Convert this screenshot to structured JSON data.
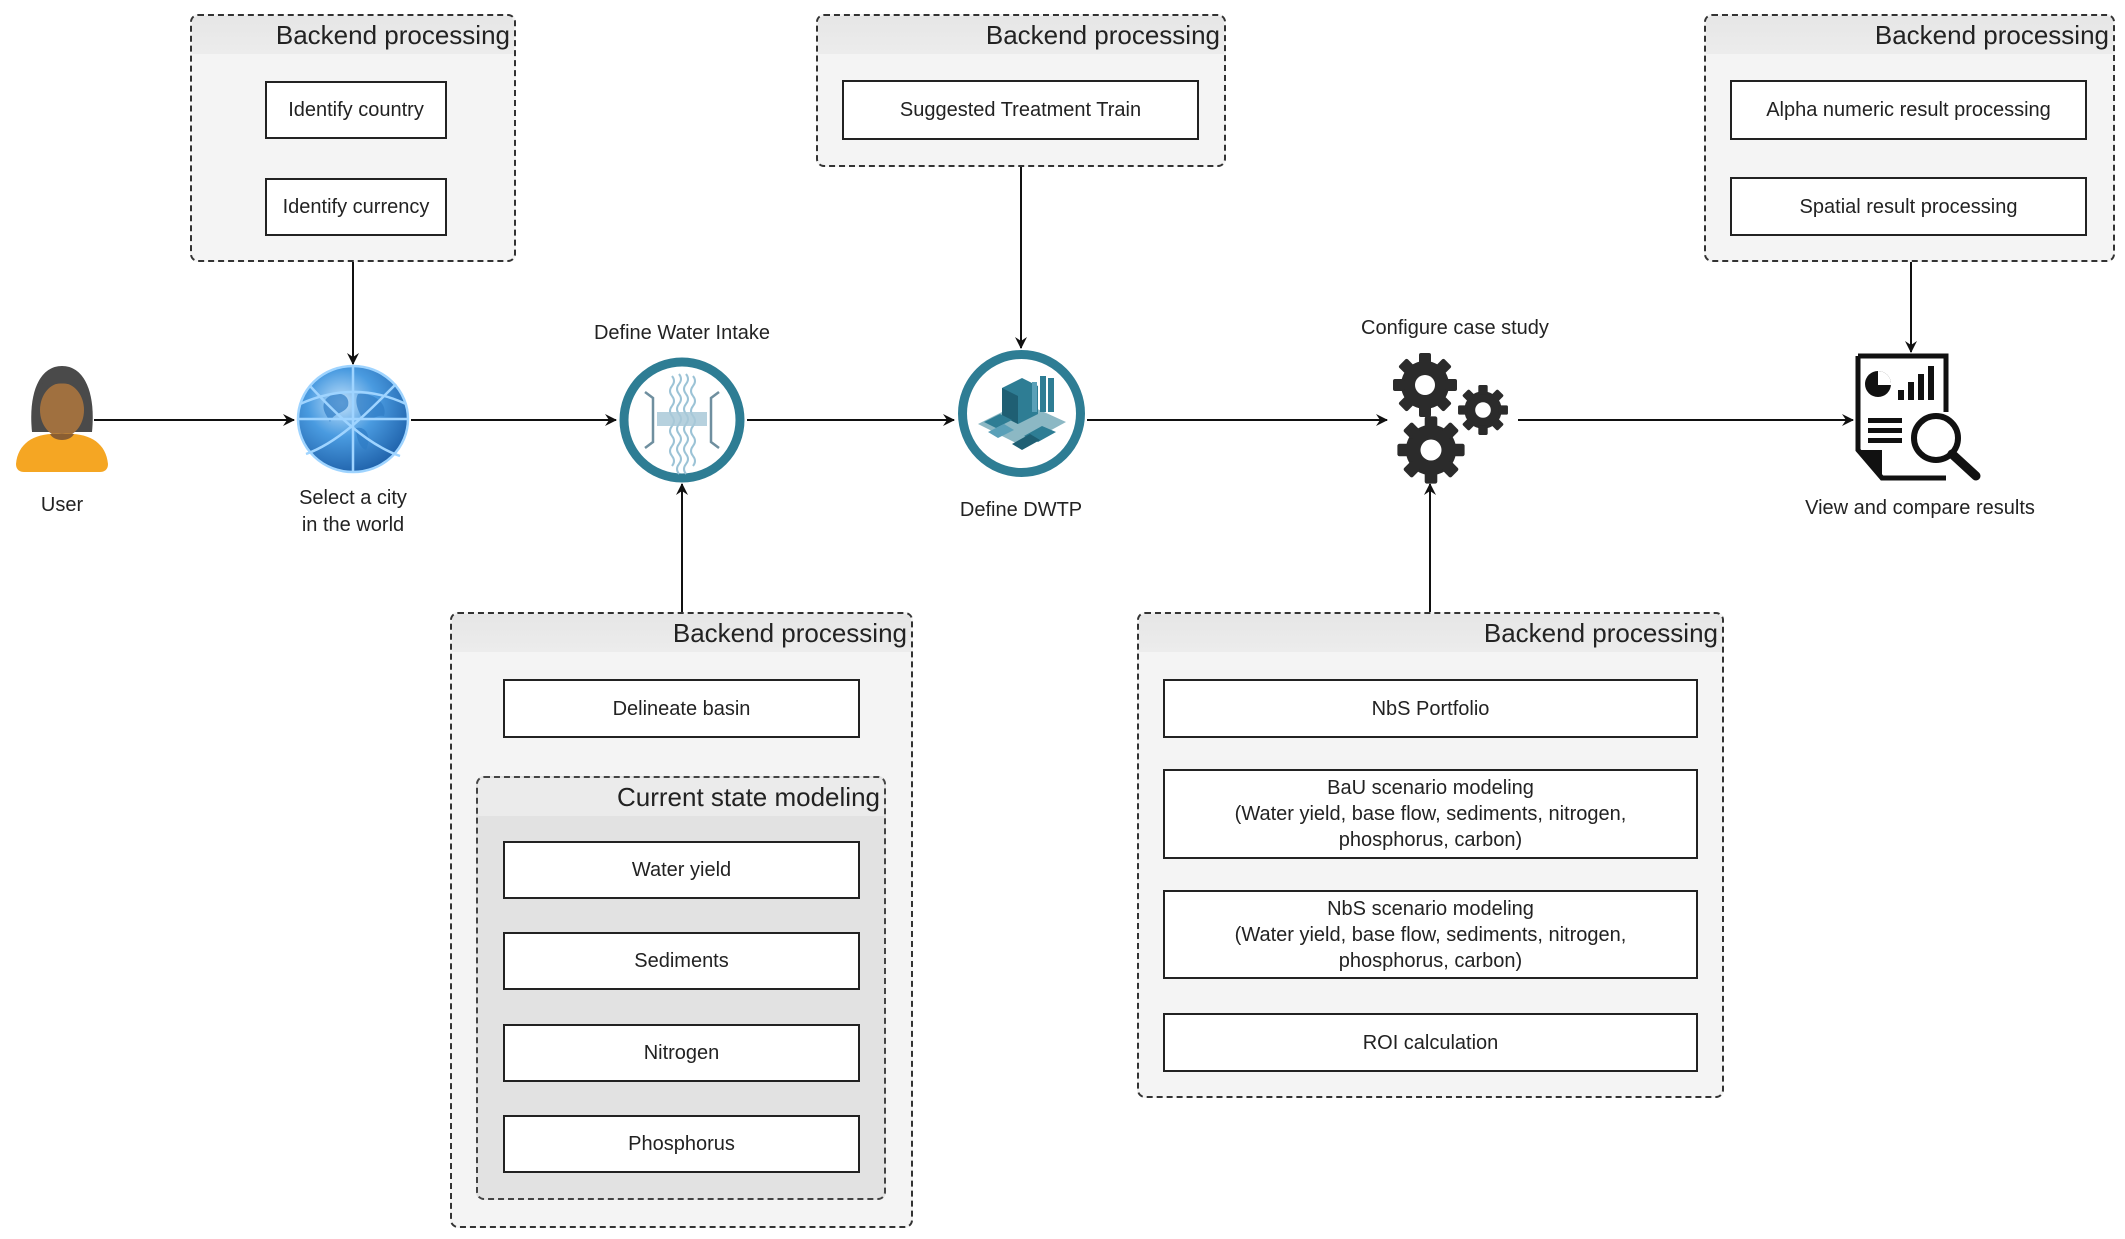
{
  "diagram": {
    "flow_nodes": [
      {
        "id": "user",
        "label": "User",
        "icon": "user-avatar-icon"
      },
      {
        "id": "city",
        "label_lines": [
          "Select a city",
          "in the world"
        ],
        "icon": "globe-icon"
      },
      {
        "id": "intake",
        "label": "Define Water Intake",
        "icon": "water-intake-icon"
      },
      {
        "id": "dwtp",
        "label": "Define DWTP",
        "icon": "treatment-plant-icon"
      },
      {
        "id": "case",
        "label": "Configure case study",
        "icon": "gears-icon"
      },
      {
        "id": "results",
        "label": "View and compare results",
        "icon": "report-search-icon"
      }
    ],
    "groups": {
      "country": {
        "title": "Backend processing",
        "items": [
          "Identify country",
          "Identify currency"
        ]
      },
      "treatment": {
        "title": "Backend processing",
        "items": [
          "Suggested Treatment Train"
        ]
      },
      "results": {
        "title": "Backend processing",
        "items": [
          "Alpha numeric result processing",
          "Spatial result processing"
        ]
      },
      "basin": {
        "title": "Backend processing",
        "items": [
          "Delineate basin"
        ],
        "subgroup": {
          "title": "Current state modeling",
          "items": [
            "Water yield",
            "Sediments",
            "Nitrogen",
            "Phosphorus"
          ]
        }
      },
      "case": {
        "title": "Backend processing",
        "items": [
          {
            "line1": "NbS Portfolio"
          },
          {
            "line1": "BaU scenario modeling",
            "line2": "(Water yield, base flow, sediments, nitrogen,",
            "line3": "phosphorus, carbon)"
          },
          {
            "line1": "NbS scenario modeling",
            "line2": "(Water yield, base flow, sediments, nitrogen,",
            "line3": "phosphorus, carbon)"
          },
          {
            "line1": "ROI calculation"
          }
        ]
      }
    },
    "colors": {
      "teal": "#2e7d94",
      "globe": "#3a8fd6",
      "user_shirt": "#f5a623",
      "user_hair": "#4a4a4a",
      "user_skin": "#a0703f"
    }
  }
}
